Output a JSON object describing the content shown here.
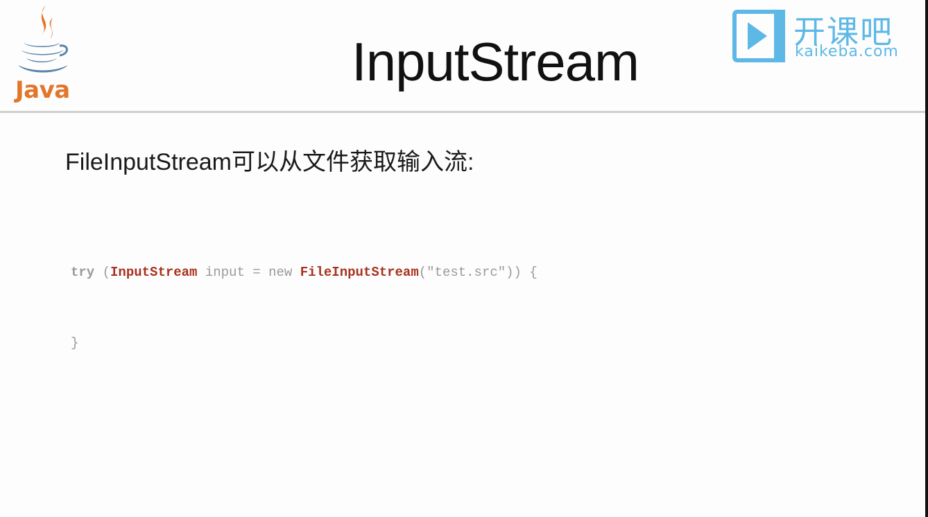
{
  "header": {
    "title": "InputStream",
    "left_logo": {
      "icon": "java-coffee-cup-icon",
      "wordmark": "Java",
      "color": "#e2762a",
      "steam_color": "#e2762a",
      "cup_color": "#5a82a8"
    },
    "right_logo": {
      "icon": "play-icon",
      "name": "开课吧",
      "url": "kaikeba.com",
      "color": "#5db8e6"
    }
  },
  "content": {
    "subtitle": "FileInputStream可以从文件获取输入流:",
    "code": {
      "line1": {
        "kw_try": "try",
        "paren_open": " (",
        "type1": "InputStream",
        "mid": " input = ",
        "kw_new": "new",
        "space": " ",
        "type2": "FileInputStream",
        "rest": "(\"test.src\")) {"
      },
      "line2": {
        "brace": "}"
      }
    }
  },
  "colors": {
    "background": "#fdfdfd",
    "divider": "#cfcfcf",
    "code_keyword": "#9a9a9a",
    "code_type": "#a8321e"
  }
}
